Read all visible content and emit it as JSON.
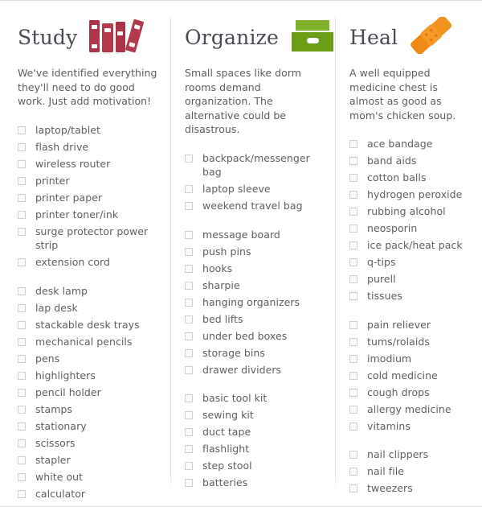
{
  "columns": [
    {
      "title": "Study",
      "icon": "books-icon",
      "icon_color": "#b0374a",
      "blurb": "We've identified everything they'll need to do good work. Just add motivation!",
      "groups": [
        {
          "items": [
            "laptop/tablet",
            "flash drive",
            "wireless router",
            "printer",
            "printer paper",
            "printer toner/ink",
            "surge protector power strip",
            "extension cord"
          ]
        },
        {
          "items": [
            "desk lamp",
            "lap desk",
            "stackable desk trays",
            "mechanical pencils",
            "pens",
            "highlighters",
            "pencil holder",
            "stamps",
            "stationary",
            "scissors",
            "stapler",
            "white out",
            "calculator"
          ]
        }
      ]
    },
    {
      "title": "Organize",
      "icon": "storage-box-icon",
      "icon_color": "#6ea11e",
      "blurb": "Small spaces like dorm rooms demand organization. The alternative could be disastrous.",
      "groups": [
        {
          "items": [
            "backpack/messenger bag",
            "laptop sleeve",
            "weekend travel bag"
          ]
        },
        {
          "items": [
            "message board",
            "push pins",
            "hooks",
            "sharpie",
            "hanging organizers",
            "bed lifts",
            "under bed boxes",
            "storage bins",
            "drawer dividers"
          ]
        },
        {
          "items": [
            "basic tool kit",
            "sewing kit",
            "duct tape",
            "flashlight",
            "step stool",
            "batteries"
          ]
        }
      ]
    },
    {
      "title": "Heal",
      "icon": "bandage-icon",
      "icon_color": "#ef8a17",
      "blurb": "A well equipped medicine chest is almost as good as mom's chicken soup.",
      "groups": [
        {
          "items": [
            "ace bandage",
            "band aids",
            "cotton balls",
            "hydrogen peroxide",
            "rubbing alcohol",
            "neosporin",
            "ice pack/heat pack",
            "q-tips",
            "purell",
            "tissues"
          ]
        },
        {
          "items": [
            "pain reliever",
            "tums/rolaids",
            "imodium",
            "cold medicine",
            "cough drops",
            "allergy medicine",
            "vitamins"
          ]
        },
        {
          "items": [
            "nail clippers",
            "nail file",
            "tweezers"
          ]
        }
      ]
    }
  ]
}
